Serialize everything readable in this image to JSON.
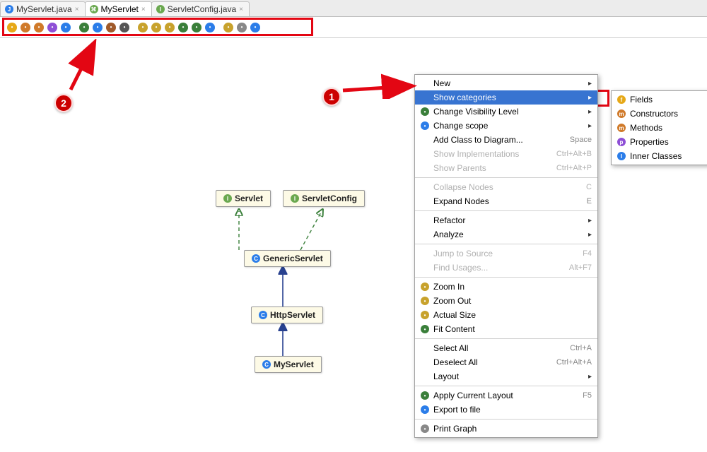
{
  "tabs": [
    {
      "label": "MyServlet.java",
      "icon_color": "#2b7de9",
      "icon_letter": "J"
    },
    {
      "label": "MyServlet",
      "icon_color": "#6aa84f",
      "icon_letter": "C"
    },
    {
      "label": "ServletConfig.java",
      "icon_color": "#2b7de9",
      "icon_letter": "I"
    }
  ],
  "active_tab_index": 1,
  "toolbar_buttons": [
    {
      "name": "cat-fields",
      "color": "#e6a817"
    },
    {
      "name": "cat-constructors",
      "color": "#d07a2a"
    },
    {
      "name": "cat-methods",
      "color": "#d07a2a"
    },
    {
      "name": "cat-properties",
      "color": "#8e4fd6"
    },
    {
      "name": "cat-inner",
      "color": "#2b7de9"
    },
    {
      "name": "sep"
    },
    {
      "name": "visibility",
      "color": "#3a7f3a"
    },
    {
      "name": "scope",
      "color": "#2b7de9"
    },
    {
      "name": "edit-colors",
      "color": "#a05a2a"
    },
    {
      "name": "link",
      "color": "#555555"
    },
    {
      "name": "sep"
    },
    {
      "name": "zoom-in",
      "color": "#c8a22c"
    },
    {
      "name": "zoom-out",
      "color": "#c8a22c"
    },
    {
      "name": "actual-size",
      "color": "#c8a22c"
    },
    {
      "name": "fit-content",
      "color": "#3a7f3a"
    },
    {
      "name": "apply-layout",
      "color": "#3a7f3a"
    },
    {
      "name": "save-layout",
      "color": "#2b7de9"
    },
    {
      "name": "sep"
    },
    {
      "name": "copy",
      "color": "#c8a22c"
    },
    {
      "name": "print",
      "color": "#888888"
    },
    {
      "name": "export",
      "color": "#2b7de9"
    }
  ],
  "diagram": {
    "nodes": {
      "servlet": {
        "label": "Servlet",
        "icon_color": "#6aa84f",
        "icon_letter": "I"
      },
      "servletConfig": {
        "label": "ServletConfig",
        "icon_color": "#6aa84f",
        "icon_letter": "I"
      },
      "genericServlet": {
        "label": "GenericServlet",
        "icon_color": "#2b7de9",
        "icon_letter": "C"
      },
      "httpServlet": {
        "label": "HttpServlet",
        "icon_color": "#2b7de9",
        "icon_letter": "C"
      },
      "myServlet": {
        "label": "MyServlet",
        "icon_color": "#2b7de9",
        "icon_letter": "C"
      }
    }
  },
  "context_menu": {
    "items": [
      {
        "label": "New",
        "icon": null,
        "submenu": true
      },
      {
        "label": "Show categories",
        "icon": null,
        "submenu": true,
        "selected": true
      },
      {
        "label": "Change Visibility Level",
        "icon": "visibility",
        "icon_color": "#3a7f3a",
        "submenu": true
      },
      {
        "label": "Change scope",
        "icon": "scope",
        "icon_color": "#2b7de9",
        "submenu": true
      },
      {
        "label": "Add Class to Diagram...",
        "shortcut": "Space"
      },
      {
        "label": "Show Implementations",
        "shortcut": "Ctrl+Alt+B",
        "disabled": true
      },
      {
        "label": "Show Parents",
        "shortcut": "Ctrl+Alt+P",
        "disabled": true
      },
      {
        "sep": true
      },
      {
        "label": "Collapse Nodes",
        "shortcut": "C",
        "disabled": true
      },
      {
        "label": "Expand Nodes",
        "shortcut": "E"
      },
      {
        "sep": true
      },
      {
        "label": "Refactor",
        "submenu": true
      },
      {
        "label": "Analyze",
        "submenu": true
      },
      {
        "sep": true
      },
      {
        "label": "Jump to Source",
        "shortcut": "F4",
        "disabled": true
      },
      {
        "label": "Find Usages...",
        "shortcut": "Alt+F7",
        "disabled": true
      },
      {
        "sep": true
      },
      {
        "label": "Zoom In",
        "icon": "zoom-in",
        "icon_color": "#c8a22c"
      },
      {
        "label": "Zoom Out",
        "icon": "zoom-out",
        "icon_color": "#c8a22c"
      },
      {
        "label": "Actual Size",
        "icon": "actual-size",
        "icon_color": "#c8a22c"
      },
      {
        "label": "Fit Content",
        "icon": "fit-content",
        "icon_color": "#3a7f3a"
      },
      {
        "sep": true
      },
      {
        "label": "Select All",
        "shortcut": "Ctrl+A"
      },
      {
        "label": "Deselect All",
        "shortcut": "Ctrl+Alt+A"
      },
      {
        "label": "Layout",
        "submenu": true
      },
      {
        "sep": true
      },
      {
        "label": "Apply Current Layout",
        "icon": "apply-layout",
        "icon_color": "#3a7f3a",
        "shortcut": "F5"
      },
      {
        "label": "Export to file",
        "icon": "export",
        "icon_color": "#2b7de9"
      },
      {
        "sep": true
      },
      {
        "label": "Print Graph",
        "icon": "print",
        "icon_color": "#888888"
      }
    ]
  },
  "submenu": {
    "items": [
      {
        "label": "Fields",
        "icon_color": "#e6a817",
        "icon_letter": "f"
      },
      {
        "label": "Constructors",
        "icon_color": "#d07a2a",
        "icon_letter": "m"
      },
      {
        "label": "Methods",
        "icon_color": "#d07a2a",
        "icon_letter": "m"
      },
      {
        "label": "Properties",
        "icon_color": "#8e4fd6",
        "icon_letter": "p"
      },
      {
        "label": "Inner Classes",
        "icon_color": "#2b7de9",
        "icon_letter": "I"
      }
    ]
  },
  "annotations": {
    "badge1": "1",
    "badge2": "2"
  }
}
